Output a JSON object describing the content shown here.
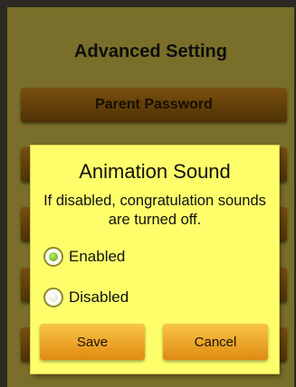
{
  "screen": {
    "title": "Advanced Setting",
    "menu": [
      {
        "label": "Parent Password"
      }
    ]
  },
  "dialog": {
    "title": "Animation Sound",
    "message": "If disabled, congratulation sounds are turned off.",
    "options": [
      {
        "label": "Enabled",
        "selected": true
      },
      {
        "label": "Disabled",
        "selected": false
      }
    ],
    "save_label": "Save",
    "cancel_label": "Cancel"
  },
  "colors": {
    "screen_bg": "#8b7f30",
    "menu_button": "#6e4a0c",
    "dialog_bg": "#fefe6b",
    "dialog_button": "#f0a82c",
    "radio_selected": "#6cc11e"
  }
}
